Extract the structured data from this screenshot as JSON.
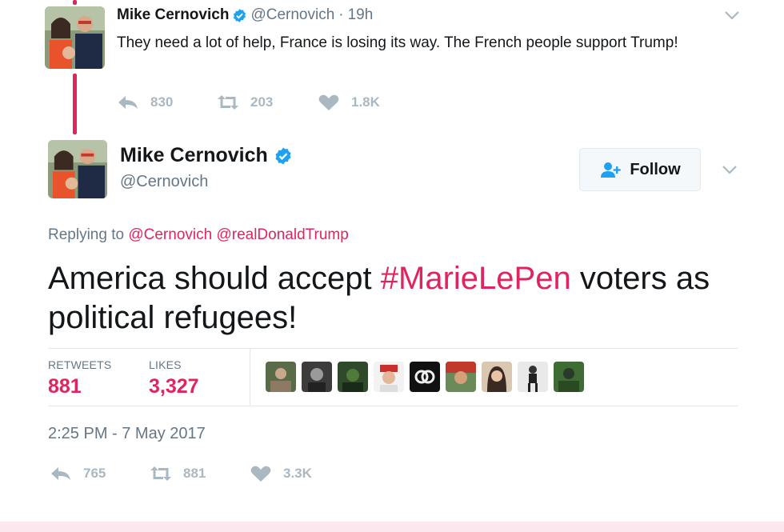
{
  "parent_tweet": {
    "name": "Mike Cernovich",
    "handle": "@Cernovich",
    "separator": "·",
    "time": "19h",
    "text": "They need a lot of help, France is losing its way. The French people support Trump!",
    "actions": {
      "replies": "830",
      "retweets": "203",
      "likes": "1.8K"
    }
  },
  "main_tweet": {
    "name": "Mike Cernovich",
    "handle": "@Cernovich",
    "follow_label": "Follow",
    "replying_prefix": "Replying to",
    "replying_to": [
      "@Cernovich",
      "@realDonaldTrump"
    ],
    "text_before": "America should accept ",
    "hashtag": "#MarieLePen",
    "text_after": " voters as political refugees!",
    "stats": {
      "retweets_label": "RETWEETS",
      "retweets_value": "881",
      "likes_label": "LIKES",
      "likes_value": "3,327"
    },
    "timestamp": "2:25 PM - 7 May 2017",
    "actions": {
      "replies": "765",
      "retweets": "881",
      "likes": "3.3K"
    }
  },
  "likers": [
    {
      "id": "liker-1",
      "color": "#5a6b4a"
    },
    {
      "id": "liker-2",
      "color": "#3c3c3c"
    },
    {
      "id": "liker-3",
      "color": "#2f4a2a"
    },
    {
      "id": "liker-4",
      "color": "#c9302c"
    },
    {
      "id": "liker-5",
      "color": "#111111"
    },
    {
      "id": "liker-6",
      "color": "#6b8a5a"
    },
    {
      "id": "liker-7",
      "color": "#d9c7b2"
    },
    {
      "id": "liker-8",
      "color": "#e9e9e9"
    },
    {
      "id": "liker-9",
      "color": "#3f6b35"
    }
  ],
  "colors": {
    "accent": "#e0245e",
    "muted": "#657786",
    "icon": "#aab8c2",
    "verified": "#1da1f2",
    "follow_icon": "#1da1f2"
  }
}
